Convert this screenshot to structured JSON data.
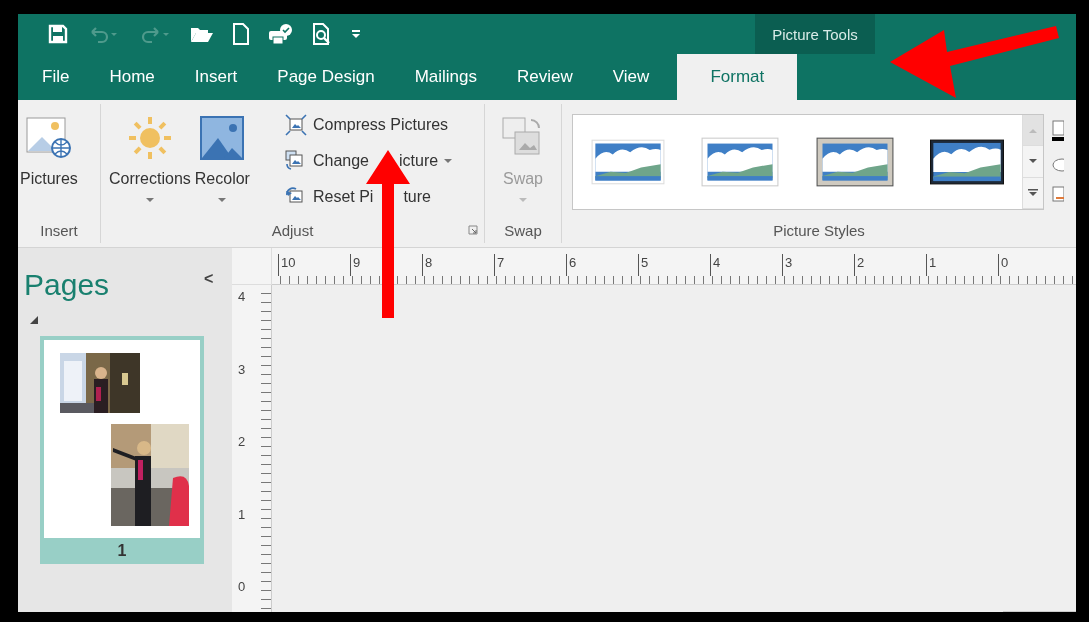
{
  "quick_access": [
    {
      "kind": "save",
      "disabled": false
    },
    {
      "kind": "undo",
      "disabled": true
    },
    {
      "kind": "redo",
      "disabled": true
    },
    {
      "kind": "open",
      "disabled": false
    },
    {
      "kind": "new",
      "disabled": false
    },
    {
      "kind": "print",
      "disabled": false
    },
    {
      "kind": "preview",
      "disabled": false
    },
    {
      "kind": "customize",
      "disabled": false
    }
  ],
  "contextual_tab": {
    "label": "Picture Tools"
  },
  "tabs": [
    {
      "label": "File",
      "selected": false
    },
    {
      "label": "Home",
      "selected": false
    },
    {
      "label": "Insert",
      "selected": false
    },
    {
      "label": "Page Design",
      "selected": false
    },
    {
      "label": "Mailings",
      "selected": false
    },
    {
      "label": "Review",
      "selected": false
    },
    {
      "label": "View",
      "selected": false
    },
    {
      "label": "Format",
      "selected": true
    }
  ],
  "ribbon": {
    "insert_group": {
      "label": "Insert",
      "buttons": [
        {
          "label": "Pictures"
        }
      ]
    },
    "adjust_group": {
      "label": "Adjust",
      "large_buttons": [
        {
          "label": "Corrections",
          "kind": "sun"
        },
        {
          "label": "Recolor",
          "kind": "landscape"
        }
      ],
      "small_buttons": [
        {
          "label_parts": [
            "Compress Pictures"
          ],
          "kind": "compress",
          "dropdown": false
        },
        {
          "label_parts": [
            "Change",
            "icture"
          ],
          "kind": "change",
          "dropdown": true
        },
        {
          "label_parts": [
            "Reset Pi",
            "ture"
          ],
          "kind": "reset",
          "dropdown": false
        }
      ]
    },
    "swap_group": {
      "label": "Swap",
      "button": {
        "label": "Swap",
        "disabled": true
      }
    },
    "styles_group": {
      "label": "Picture Styles",
      "styles": [
        {
          "kind": "simple"
        },
        {
          "kind": "soft"
        },
        {
          "kind": "matted"
        },
        {
          "kind": "dark"
        }
      ]
    }
  },
  "pages_pane": {
    "title": "Pages",
    "collapse": "<",
    "pages": [
      {
        "number": "1",
        "selected": true
      }
    ]
  },
  "rulers": {
    "horizontal": [
      "10",
      "9",
      "8",
      "7",
      "6",
      "5",
      "4",
      "3",
      "2",
      "1",
      "0"
    ],
    "vertical": [
      "4",
      "3",
      "2",
      "1",
      "0"
    ]
  }
}
